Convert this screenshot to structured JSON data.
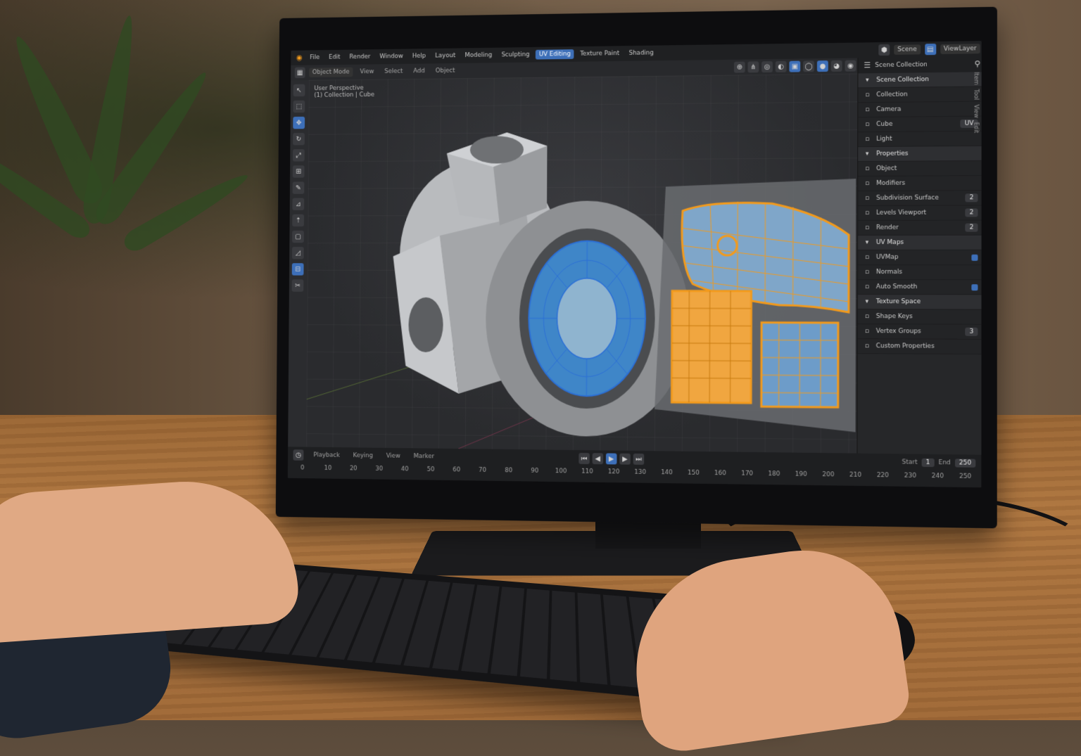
{
  "top_menu": {
    "items": [
      "File",
      "Edit",
      "Render",
      "Window",
      "Help",
      "Layout",
      "Modeling",
      "Sculpting",
      "UV Editing",
      "Texture Paint",
      "Shading"
    ],
    "active_index": 8,
    "scene_label": "Scene",
    "view_layer_label": "ViewLayer"
  },
  "toolbar": {
    "mode_label": "Object Mode",
    "view_label": "View",
    "select_label": "Select",
    "add_label": "Add",
    "object_label": "Object"
  },
  "viewport": {
    "info_line1": "User Perspective",
    "info_line2": "(1) Collection | Cube"
  },
  "model": {
    "body_color": "#9fa1a4",
    "uv_wire_color": "#f29a1c",
    "uv_fill_color": "#5a8fc2",
    "face_wire_color": "#2b6fd6"
  },
  "right_panel": {
    "header_tab": "Scene Collection",
    "rows": [
      {
        "label": "Scene Collection",
        "kind": "section"
      },
      {
        "label": "Collection",
        "kind": "field"
      },
      {
        "label": "Camera",
        "kind": "field"
      },
      {
        "label": "Cube",
        "kind": "field",
        "value": "UV"
      },
      {
        "label": "Light",
        "kind": "field"
      },
      {
        "label": "Properties",
        "kind": "section"
      },
      {
        "label": "Object",
        "kind": "field"
      },
      {
        "label": "Modifiers",
        "kind": "field"
      },
      {
        "label": "Subdivision Surface",
        "kind": "field",
        "value": "2"
      },
      {
        "label": "Levels Viewport",
        "kind": "field",
        "value": "2"
      },
      {
        "label": "Render",
        "kind": "field",
        "value": "2"
      },
      {
        "label": "UV Maps",
        "kind": "section"
      },
      {
        "label": "UVMap",
        "kind": "field",
        "check": true
      },
      {
        "label": "Normals",
        "kind": "field"
      },
      {
        "label": "Auto Smooth",
        "kind": "field",
        "check": true
      },
      {
        "label": "Texture Space",
        "kind": "section"
      },
      {
        "label": "Shape Keys",
        "kind": "field"
      },
      {
        "label": "Vertex Groups",
        "kind": "field",
        "value": "3"
      },
      {
        "label": "Custom Properties",
        "kind": "field"
      }
    ],
    "side_tabs": [
      "Item",
      "Tool",
      "View",
      "Edit"
    ]
  },
  "statusbar": {
    "playback_label": "Playback",
    "keying_label": "Keying",
    "view_label": "View",
    "marker_label": "Marker",
    "frames": [
      "0",
      "10",
      "20",
      "30",
      "40",
      "50",
      "60",
      "70",
      "80",
      "90",
      "100",
      "110",
      "120",
      "130",
      "140",
      "150",
      "160",
      "170",
      "180",
      "190",
      "200",
      "210",
      "220",
      "230",
      "240",
      "250"
    ],
    "start_label": "Start",
    "start_value": "1",
    "end_label": "End",
    "end_value": "250"
  }
}
